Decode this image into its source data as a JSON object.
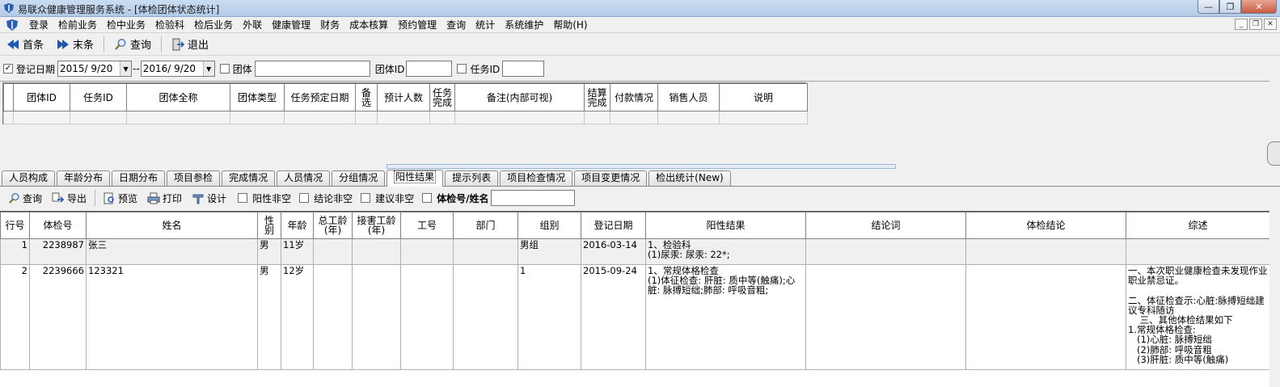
{
  "window": {
    "title": "易联众健康管理服务系统 - [体检团体状态统计]"
  },
  "menu": [
    "登录",
    "检前业务",
    "检中业务",
    "检验科",
    "检后业务",
    "外联",
    "健康管理",
    "财务",
    "成本核算",
    "预约管理",
    "查询",
    "统计",
    "系统维护",
    "帮助(H)"
  ],
  "toolbar": {
    "first": "首条",
    "last": "末条",
    "query": "查询",
    "exit": "退出"
  },
  "filter": {
    "reg_date_label": "登记日期",
    "date_from": "2015/ 9/20",
    "sep": "--",
    "date_to": "2016/ 9/20",
    "group_label": "团体",
    "group_value": "",
    "group_id_label": "团体ID",
    "group_id_value": "",
    "task_id_label": "任务ID",
    "task_id_value": ""
  },
  "group_table": {
    "headers": [
      "团体ID",
      "任务ID",
      "团体全称",
      "团体类型",
      "任务预定日期",
      "备选",
      "预计人数",
      "任务完成",
      "备注(内部可视)",
      "结算完成",
      "付款情况",
      "销售人员",
      "说明"
    ]
  },
  "tabs": [
    "人员构成",
    "年龄分布",
    "日期分布",
    "项目参检",
    "完成情况",
    "人员情况",
    "分组情况",
    "阳性结果",
    "提示列表",
    "项目检查情况",
    "项目变更情况",
    "检出统计(New)"
  ],
  "active_tab": "阳性结果",
  "toolbar2": {
    "query": "查询",
    "export": "导出",
    "preview": "预览",
    "print": "打印",
    "design": "设计",
    "positive_nonempty": "阳性非空",
    "conclusion_nonempty": "结论非空",
    "advice_nonempty": "建议非空",
    "search_label": "体检号/姓名",
    "search_value": ""
  },
  "result_table": {
    "headers": [
      "行号",
      "体检号",
      "姓名",
      "性别",
      "年龄",
      "总工龄(年)",
      "接害工龄(年)",
      "工号",
      "部门",
      "组别",
      "登记日期",
      "阳性结果",
      "结论词",
      "体检结论",
      "综述"
    ],
    "rows": [
      {
        "no": "1",
        "exam_id": "2238987",
        "name": "张三",
        "sex": "男",
        "age": "11岁",
        "total_years": "",
        "exposure_years": "",
        "job_no": "",
        "dept": "",
        "group": "男组",
        "reg_date": "2016-03-14",
        "positive": "1、检验科\n(1)尿汞: 尿汞: 22*;",
        "conclusion_word": "",
        "exam_conclusion": "",
        "summary": ""
      },
      {
        "no": "2",
        "exam_id": "2239666",
        "name": "123321",
        "sex": "男",
        "age": "12岁",
        "total_years": "",
        "exposure_years": "",
        "job_no": "",
        "dept": "",
        "group": "1",
        "reg_date": "2015-09-24",
        "positive": "1、常规体格检查\n(1)体征检查: 肝脏: 质中等(触痛);心脏: 脉搏短绌;肺部: 呼吸音粗;",
        "conclusion_word": "",
        "exam_conclusion": "",
        "summary": "一、本次职业健康检查未发现作业职业禁忌证。\n\n二、体征检查示:心脏:脉搏短绌建议专科随访\n    三、其他体检结果如下\n1.常规体格检查:\n   (1)心脏: 脉搏短绌\n   (2)肺部: 呼吸音粗\n   (3)肝脏: 质中等(触痛)"
      }
    ]
  }
}
